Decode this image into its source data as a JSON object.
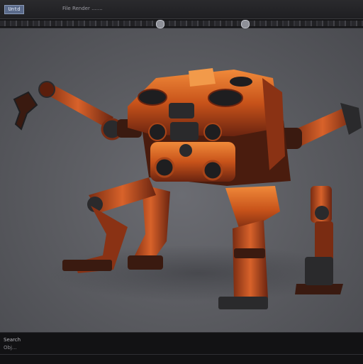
{
  "window": {
    "app_icon_label": "Untd",
    "title": "File  Render  ......."
  },
  "toolbar": {
    "buttons": [
      "viewport-toggle",
      "render-toggle"
    ]
  },
  "viewport": {
    "subject": "orange robot mech",
    "colors": {
      "body": "#c8531a",
      "body_dark": "#6a2410",
      "metal": "#2a2a2c",
      "background": "#5e5f64"
    }
  },
  "status": {
    "label": "Search",
    "sub": "Obj..."
  }
}
